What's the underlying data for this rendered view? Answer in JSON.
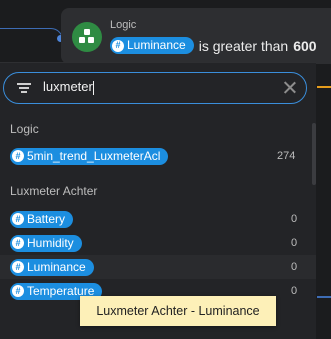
{
  "node": {
    "title": "Logic",
    "condition_variable": "Luminance",
    "condition_operator": "is greater than",
    "condition_value": "600",
    "accent_color": "#2f8b43"
  },
  "search": {
    "value": "luxmeter",
    "placeholder": ""
  },
  "groups": [
    {
      "label": "Logic",
      "items": [
        {
          "name": "5min_trend_LuxmeterAcl",
          "count": "274"
        }
      ]
    },
    {
      "label": "Luxmeter Achter",
      "items": [
        {
          "name": "Battery",
          "count": "0"
        },
        {
          "name": "Humidity",
          "count": "0"
        },
        {
          "name": "Luminance",
          "count": "0"
        },
        {
          "name": "Temperature",
          "count": "0"
        }
      ]
    }
  ],
  "tooltip": {
    "text": "Luxmeter Achter - Luminance"
  },
  "colors": {
    "pill": "#1c8ee0",
    "focus": "#3a8edb",
    "wire_blue": "#3d6cb4",
    "wire_orange": "#e59c1c"
  },
  "icons": [
    "logic-node-icon",
    "filter-icon",
    "clear-icon",
    "hash-icon"
  ]
}
